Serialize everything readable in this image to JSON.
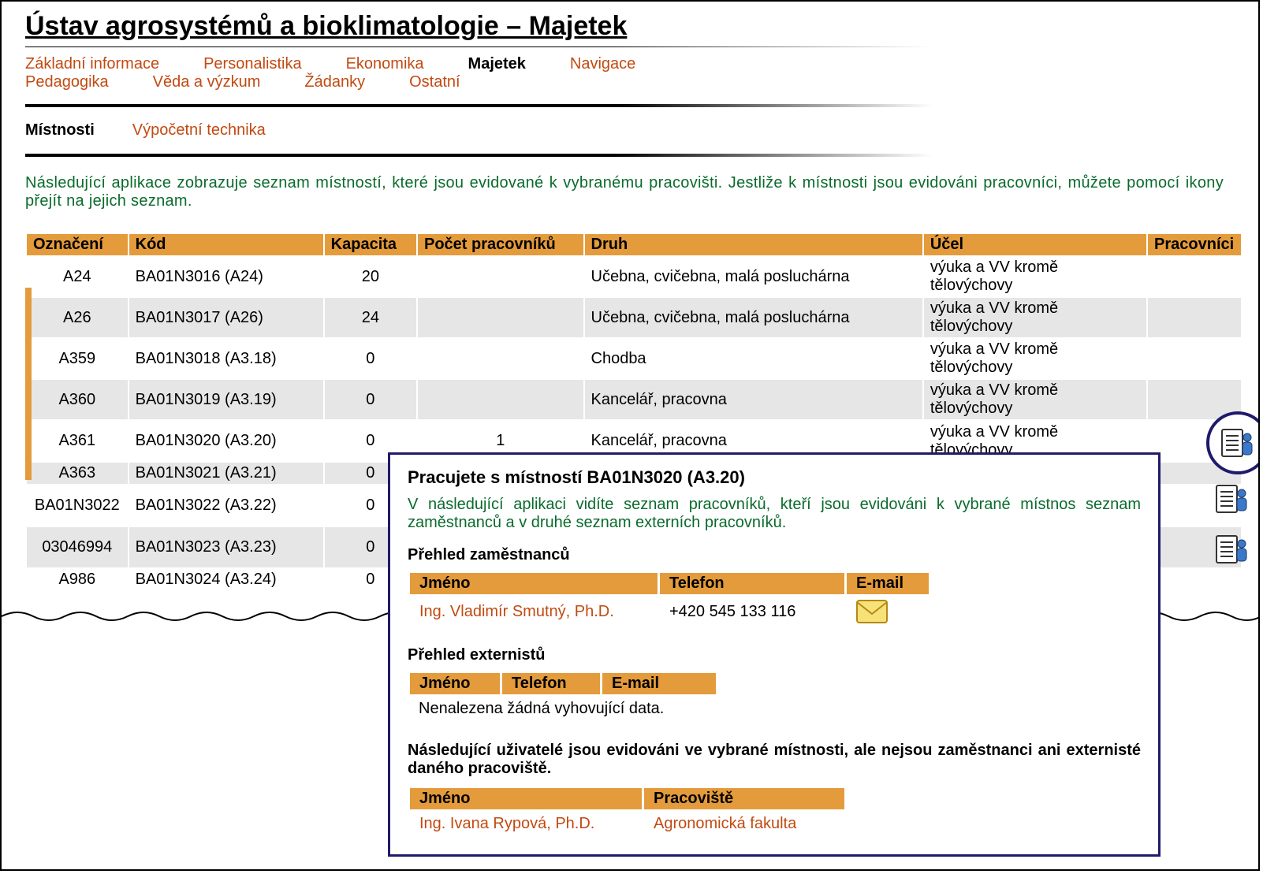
{
  "title_link": "Ústav agrosystémů a bioklimatologie",
  "title_suffix": " – Majetek",
  "nav1": {
    "r1": [
      "Základní informace",
      "Personalistika",
      "Ekonomika",
      "Majetek",
      "Navigace"
    ],
    "r2": [
      "Pedagogika",
      "Věda a výzkum",
      "Žádanky",
      "Ostatní"
    ],
    "active": "Majetek"
  },
  "nav2": {
    "items": [
      "Místnosti",
      "Výpočetní technika"
    ],
    "active": "Místnosti"
  },
  "intro": "Následující aplikace zobrazuje seznam místností, které jsou evidované k vybranému pracovišti. Jestliže k místnosti jsou evidováni pracovníci, můžete pomocí ikony přejít na jejich seznam.",
  "cols": {
    "c0": "Označení",
    "c1": "Kód",
    "c2": "Kapacita",
    "c3": "Počet pracovníků",
    "c4": "Druh",
    "c5": "Účel",
    "c6": "Pracovníci"
  },
  "rows": [
    {
      "a": "A24",
      "b": "BA01N3016 (A24)",
      "c": "20",
      "d": "",
      "e": "Učebna, cvičebna, malá posluchárna",
      "f": "výuka a VV kromě tělovýchovy"
    },
    {
      "a": "A26",
      "b": "BA01N3017 (A26)",
      "c": "24",
      "d": "",
      "e": "Učebna, cvičebna, malá posluchárna",
      "f": "výuka a VV kromě tělovýchovy"
    },
    {
      "a": "A359",
      "b": "BA01N3018 (A3.18)",
      "c": "0",
      "d": "",
      "e": "Chodba",
      "f": "výuka a VV kromě tělovýchovy"
    },
    {
      "a": "A360",
      "b": "BA01N3019 (A3.19)",
      "c": "0",
      "d": "",
      "e": "Kancelář, pracovna",
      "f": "výuka a VV kromě tělovýchovy"
    },
    {
      "a": "A361",
      "b": "BA01N3020 (A3.20)",
      "c": "0",
      "d": "1",
      "e": "Kancelář, pracovna",
      "f": "výuka a VV kromě tělovýchovy"
    },
    {
      "a": "A363",
      "b": "BA01N3021 (A3.21)",
      "c": "0",
      "d": "",
      "e": "",
      "f": ""
    },
    {
      "a": "BA01N3022",
      "b": "BA01N3022 (A3.22)",
      "c": "0",
      "d": "",
      "e": "",
      "f": ""
    },
    {
      "a": "03046994",
      "b": "BA01N3023 (A3.23)",
      "c": "0",
      "d": "",
      "e": "",
      "f": ""
    },
    {
      "a": "A986",
      "b": "BA01N3024 (A3.24)",
      "c": "0",
      "d": "",
      "e": "",
      "f": ""
    }
  ],
  "popup": {
    "title": "Pracujete s místností BA01N3020 (A3.20)",
    "intro": "V následující aplikaci vidíte seznam pracovníků, kteří jsou evidováni k vybrané místnos seznam zaměstnanců a v druhé seznam externích pracovníků.",
    "s1": "Přehled zaměstnanců",
    "t1h": {
      "a": "Jméno",
      "b": "Telefon",
      "c": "E-mail"
    },
    "t1r": {
      "a": "Ing. Vladimír Smutný, Ph.D.",
      "b": "+420 545 133 116"
    },
    "s2": "Přehled externistů",
    "t2h": {
      "a": "Jméno",
      "b": "Telefon",
      "c": "E-mail"
    },
    "nodata": "Nenalezena žádná vyhovující data.",
    "note": "Následující uživatelé jsou evidováni ve vybrané místnosti, ale nejsou zaměstnanci ani externisté daného pracoviště.",
    "t3h": {
      "a": "Jméno",
      "b": "Pracoviště"
    },
    "t3r": {
      "a": "Ing. Ivana Rypová, Ph.D.",
      "b": "Agronomická fakulta"
    }
  }
}
